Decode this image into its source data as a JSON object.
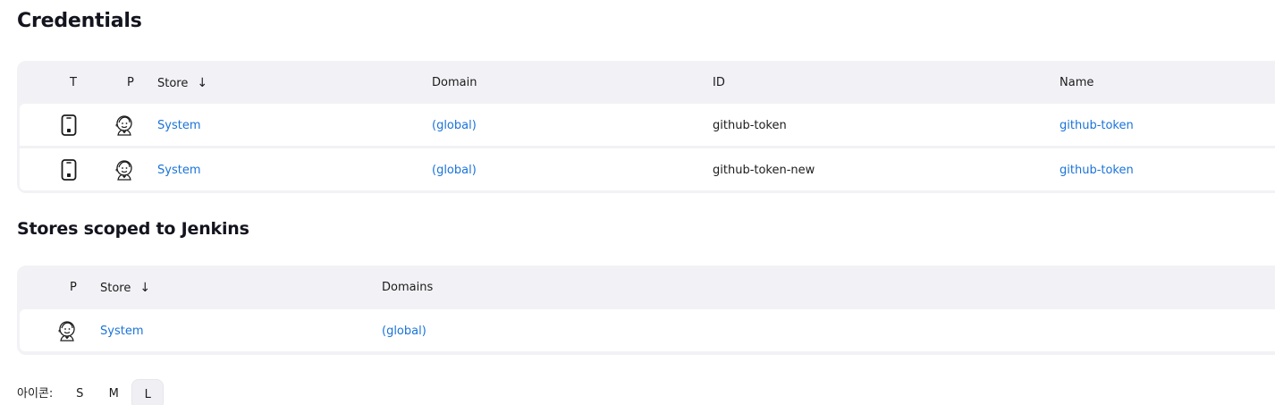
{
  "page": {
    "title": "Credentials",
    "stores_title": "Stores scoped to Jenkins"
  },
  "credentials_table": {
    "headers": {
      "t": "T",
      "p": "P",
      "store": "Store",
      "sort_arrow": "↓",
      "domain": "Domain",
      "id": "ID",
      "name": "Name"
    },
    "rows": [
      {
        "type_icon": "mobile-phone-icon",
        "provider_icon": "jenkins-butler-icon",
        "store": "System",
        "domain": "(global)",
        "id": "github-token",
        "name": "github-token"
      },
      {
        "type_icon": "mobile-phone-icon",
        "provider_icon": "jenkins-butler-icon",
        "store": "System",
        "domain": "(global)",
        "id": "github-token-new",
        "name": "github-token"
      }
    ]
  },
  "stores_table": {
    "headers": {
      "p": "P",
      "store": "Store",
      "sort_arrow": "↓",
      "domains": "Domains"
    },
    "rows": [
      {
        "provider_icon": "jenkins-butler-icon",
        "store": "System",
        "domains": "(global)"
      }
    ]
  },
  "icon_size": {
    "label": "아이콘:",
    "options": [
      "S",
      "M",
      "L"
    ],
    "selected": "L"
  },
  "colors": {
    "link": "#1a73d9",
    "table_bg": "#f2f2f6"
  }
}
